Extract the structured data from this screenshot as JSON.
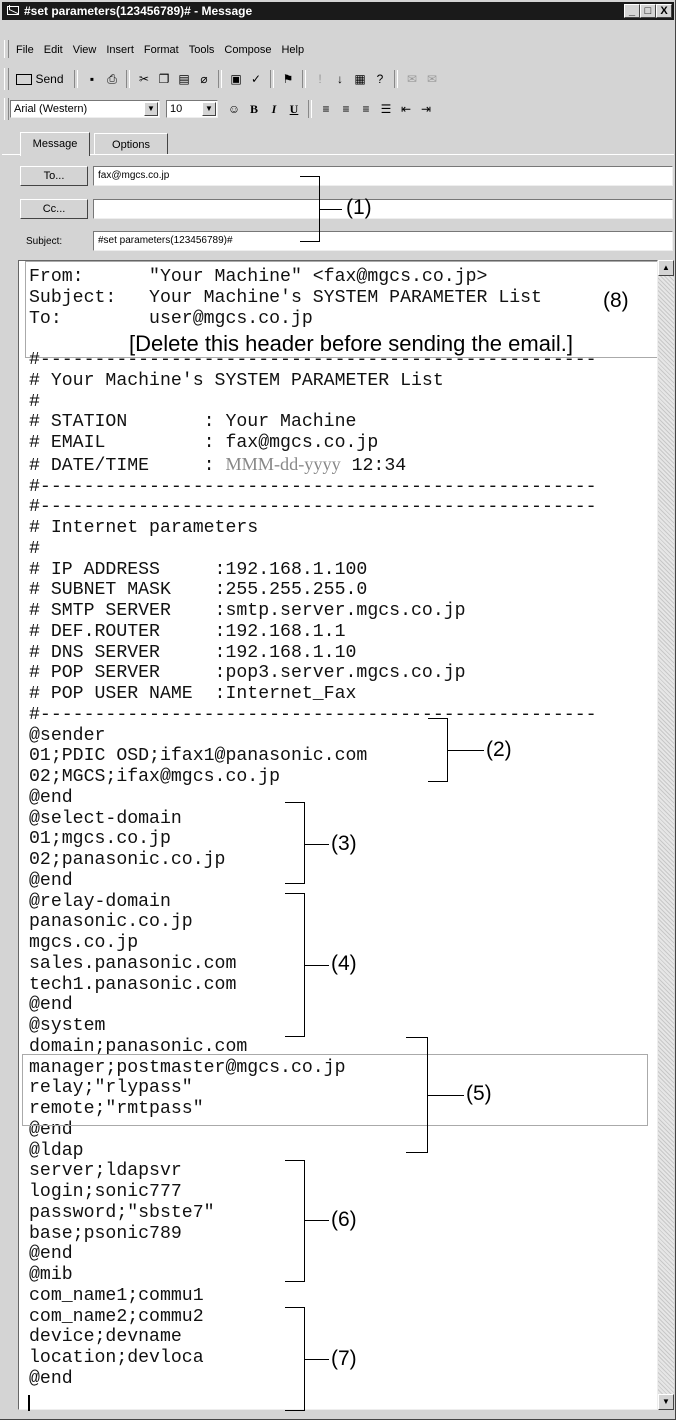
{
  "window": {
    "title": "#set parameters(123456789)# - Message",
    "btn_min": "_",
    "btn_max": "□",
    "btn_close": "X"
  },
  "menu": [
    "File",
    "Edit",
    "View",
    "Insert",
    "Format",
    "Tools",
    "Compose",
    "Help"
  ],
  "toolbar": {
    "send_label": "Send"
  },
  "format": {
    "font": "Arial (Western)",
    "size": "10",
    "bold": "B",
    "italic": "I",
    "underline": "U"
  },
  "tabs": [
    "Message",
    "Options"
  ],
  "header": {
    "to_label": "To...",
    "to_value": "fax@mgcs.co.jp",
    "cc_label": "Cc...",
    "cc_value": "",
    "subject_label": "Subject:",
    "subject_value": "#set parameters(123456789)#"
  },
  "body": {
    "header_lines": [
      "From:      \"Your Machine\" <fax@mgcs.co.jp>",
      "Subject:   Your Machine's SYSTEM PARAMETER List",
      "To:        user@mgcs.co.jp"
    ],
    "delete_note": "[Delete this header before sending the email.]",
    "lines_a": [
      "#---------------------------------------------------",
      "# Your Machine's SYSTEM PARAMETER List",
      "#",
      "# STATION       : Your Machine",
      "# EMAIL         : fax@mgcs.co.jp"
    ],
    "datetime_prefix": "# DATE/TIME     : ",
    "datetime_format": "MMM-dd-yyyy",
    "datetime_time": " 12:34",
    "lines_b": [
      "#---------------------------------------------------",
      "#---------------------------------------------------",
      "# Internet parameters",
      "#",
      "# IP ADDRESS     :192.168.1.100",
      "# SUBNET MASK    :255.255.255.0",
      "# SMTP SERVER    :smtp.server.mgcs.co.jp",
      "# DEF.ROUTER     :192.168.1.1",
      "# DNS SERVER     :192.168.1.10",
      "# POP SERVER     :pop3.server.mgcs.co.jp",
      "# POP USER NAME  :Internet_Fax",
      "#---------------------------------------------------",
      "@sender",
      "01;PDIC OSD;ifax1@panasonic.com",
      "02;MGCS;ifax@mgcs.co.jp",
      "@end",
      "@select-domain",
      "01;mgcs.co.jp",
      "02;panasonic.co.jp",
      "@end",
      "@relay-domain",
      "panasonic.co.jp",
      "mgcs.co.jp",
      "sales.panasonic.com",
      "tech1.panasonic.com",
      "@end",
      "@system",
      "domain;panasonic.com",
      "manager;postmaster@mgcs.co.jp",
      "relay;\"rlypass\"",
      "remote;\"rmtpass\"",
      "@end",
      "@ldap",
      "server;ldapsvr",
      "login;sonic777",
      "password;\"sbste7\"",
      "base;psonic789",
      "@end",
      "@mib",
      "com_name1;commu1",
      "com_name2;commu2",
      "device;devname",
      "location;devloca",
      "@end"
    ]
  },
  "callouts": [
    "(1)",
    "(2)",
    "(3)",
    "(4)",
    "(5)",
    "(6)",
    "(7)",
    "(8)"
  ],
  "colors": {
    "titlebar": "#1a1a1a",
    "chrome": "#d4d4d4",
    "placeholder_text": "#888888"
  }
}
